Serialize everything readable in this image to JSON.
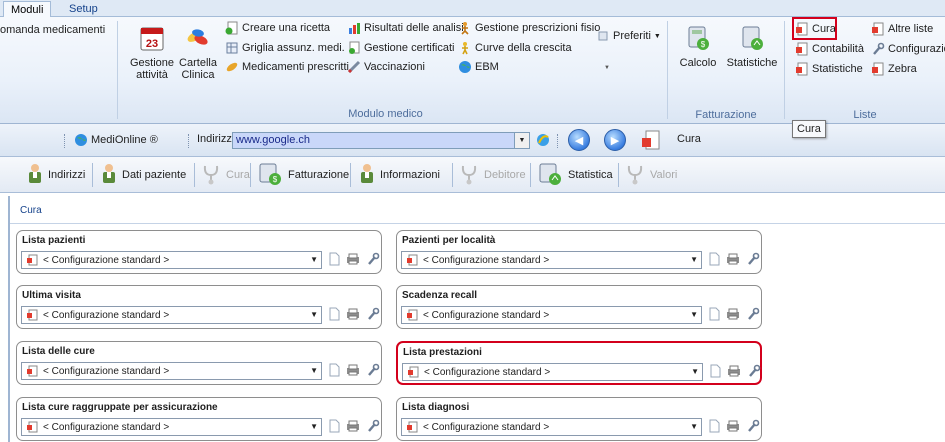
{
  "ribbon_tabs": {
    "moduli": "Moduli",
    "setup": "Setup"
  },
  "ribbon": {
    "partial_item": "omanda medicamenti",
    "gestione_attivita": [
      "Gestione",
      "attività"
    ],
    "cartella_clinica": [
      "Cartella",
      "Clinica"
    ],
    "creare_ricetta": "Creare una ricetta",
    "griglia": "Griglia assunz. medi.",
    "medicamenti": "Medicamenti prescritti",
    "risultati": "Risultati delle analisi",
    "certificati": "Gestione certificati",
    "vaccinazioni": "Vaccinazioni",
    "prescrizioni_fisio": "Gestione prescrizioni fisio",
    "curve": "Curve della crescita",
    "ebm": "EBM",
    "preferiti": "Preferiti",
    "group_modulo_medico": "Modulo medico",
    "calcolo": "Calcolo",
    "statistiche_fatt": "Statistiche",
    "group_fatturazione": "Fatturazione",
    "cura": "Cura",
    "contabilita": "Contabilità",
    "statistiche_liste": "Statistiche",
    "altre_liste": "Altre liste",
    "configurazion": "Configurazion",
    "zebra": "Zebra",
    "group_liste": "Liste"
  },
  "addressbar": {
    "medionline": "MediOnline ®",
    "indirizzo_label": "Indirizzo",
    "url": "www.google.ch",
    "current_page": "Cura",
    "tooltip": "Cura"
  },
  "toolbar": {
    "indirizzi": "Indirizzi",
    "dati_paziente": "Dati paziente",
    "cura": "Cura",
    "fatturazione": "Fatturazione",
    "informazioni": "Informazioni",
    "debitore": "Debitore",
    "statistica": "Statistica",
    "valori": "Valori"
  },
  "breadcrumb": "Cura",
  "cards": [
    {
      "title": "Lista pazienti",
      "value": "< Configurazione standard >"
    },
    {
      "title": "Pazienti per località",
      "value": "< Configurazione standard >"
    },
    {
      "title": "Ultima visita",
      "value": "< Configurazione standard >"
    },
    {
      "title": "Scadenza recall",
      "value": "< Configurazione standard >"
    },
    {
      "title": "Lista delle cure",
      "value": "< Configurazione standard >"
    },
    {
      "title": "Lista prestazioni",
      "value": "< Configurazione standard >"
    },
    {
      "title": "Lista cure raggruppate per assicurazione",
      "value": "< Configurazione standard >"
    },
    {
      "title": "Lista diagnosi",
      "value": "< Configurazione standard >"
    }
  ],
  "colors": {
    "highlight": "#d3001c",
    "ribbon_label": "#4d6d9c",
    "address_bg": "#c9d7f9"
  }
}
